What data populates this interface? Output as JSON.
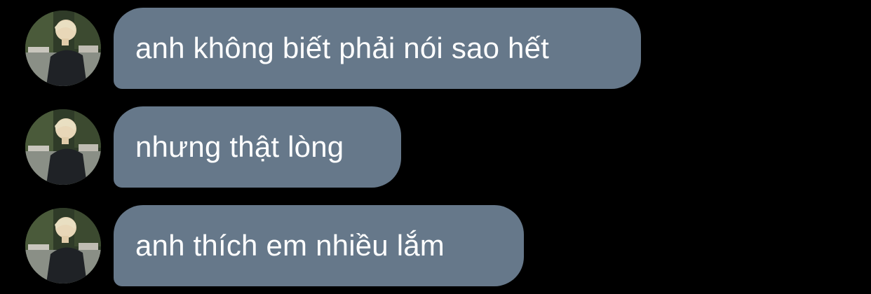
{
  "messages": [
    {
      "text": "anh không biết phải nói sao hết"
    },
    {
      "text": "nhưng thật lòng"
    },
    {
      "text": "anh thích em nhiều lắm"
    }
  ],
  "colors": {
    "background": "#000000",
    "bubble": "#66788a",
    "text": "#ffffff"
  },
  "icons": {
    "avatar": "sender-profile-photo"
  }
}
